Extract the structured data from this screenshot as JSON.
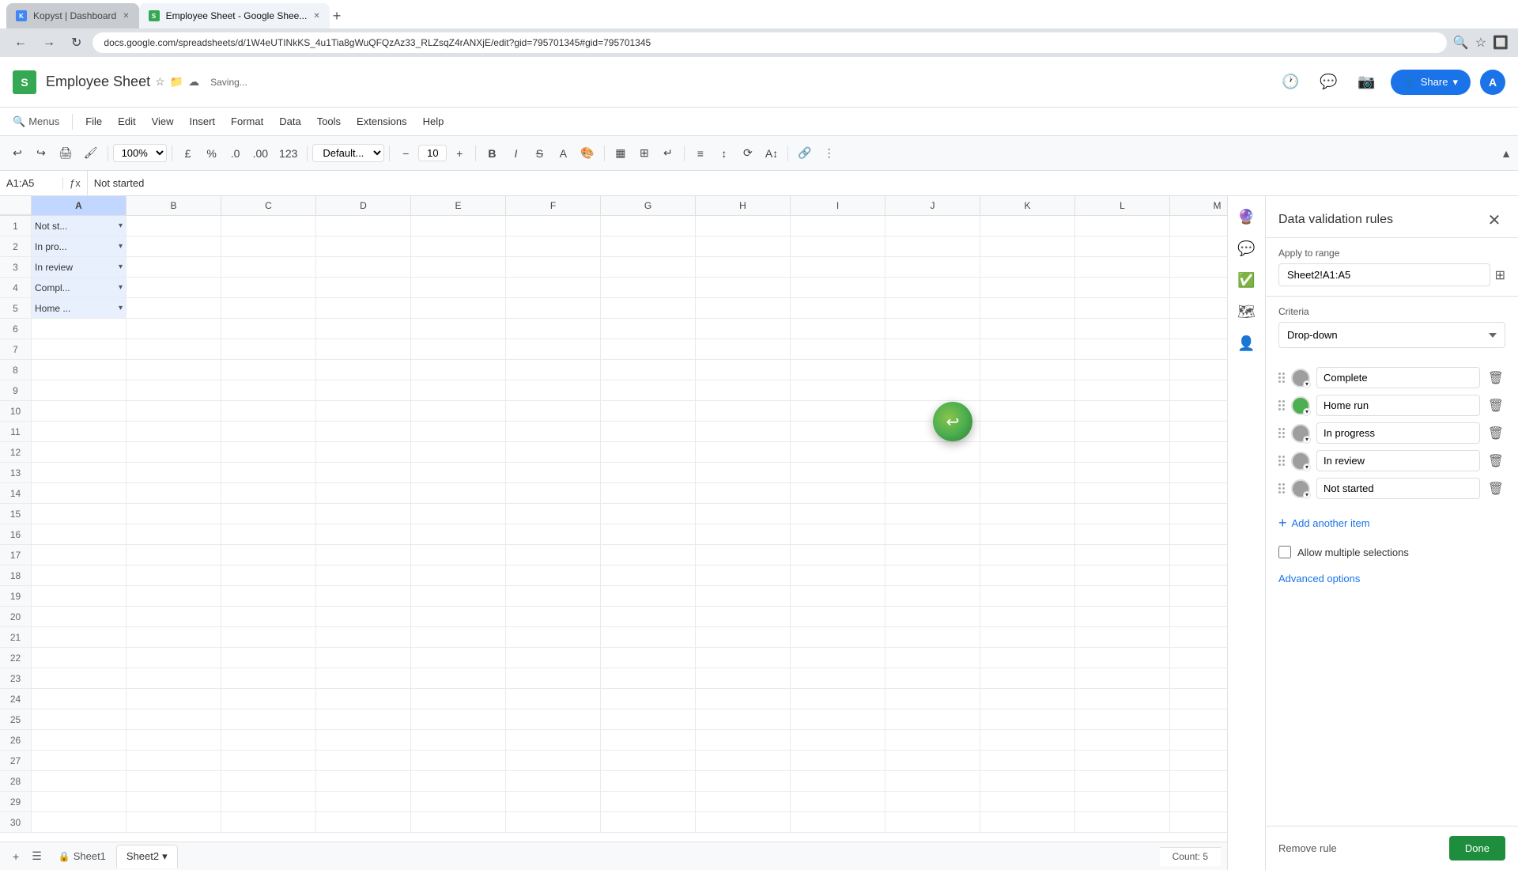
{
  "browser": {
    "tabs": [
      {
        "id": "kopyst",
        "label": "Kopyst | Dashboard",
        "active": false,
        "favicon_color": "#4285f4"
      },
      {
        "id": "sheets",
        "label": "Employee Sheet - Google Shee...",
        "active": true,
        "favicon_color": "#34a853"
      }
    ],
    "address": "docs.google.com/spreadsheets/d/1W4eUTINkKS_4u1Tia8gWuQFQzAz33_RLZsqZ4rANXjE/edit?gid=795701345#gid=795701345",
    "nav": {
      "back": "←",
      "forward": "→",
      "refresh": "↻"
    }
  },
  "header": {
    "logo_letter": "S",
    "file_title": "Employee Sheet",
    "saving_text": "Saving...",
    "share_label": "Share",
    "avatar_letter": "A"
  },
  "menu": {
    "search_label": "Menus",
    "items": [
      "File",
      "Edit",
      "View",
      "Insert",
      "Format",
      "Data",
      "Tools",
      "Extensions",
      "Help"
    ]
  },
  "toolbar": {
    "zoom": "100%",
    "currency": "£",
    "percent": "%",
    "decimal_dec": ".0",
    "decimal_inc": ".00",
    "format_num": "123",
    "font_family": "Default...",
    "font_size": "10"
  },
  "formula_bar": {
    "cell_ref": "A1:A5",
    "content": "Not started"
  },
  "spreadsheet": {
    "columns": [
      "A",
      "B",
      "C",
      "D",
      "E",
      "F",
      "G",
      "H",
      "I",
      "J",
      "K",
      "L",
      "M"
    ],
    "rows": [
      {
        "num": "1",
        "a_value": "Not st...",
        "has_dropdown": true
      },
      {
        "num": "2",
        "a_value": "In pro...",
        "has_dropdown": true
      },
      {
        "num": "3",
        "a_value": "In review",
        "has_dropdown": true
      },
      {
        "num": "4",
        "a_value": "Compl...",
        "has_dropdown": true
      },
      {
        "num": "5",
        "a_value": "Home ...",
        "has_dropdown": true
      },
      {
        "num": "6",
        "a_value": "",
        "has_dropdown": false
      },
      {
        "num": "7",
        "a_value": "",
        "has_dropdown": false
      },
      {
        "num": "8",
        "a_value": "",
        "has_dropdown": false
      },
      {
        "num": "9",
        "a_value": "",
        "has_dropdown": false
      },
      {
        "num": "10",
        "a_value": "",
        "has_dropdown": false
      },
      {
        "num": "11",
        "a_value": "",
        "has_dropdown": false
      },
      {
        "num": "12",
        "a_value": "",
        "has_dropdown": false
      },
      {
        "num": "13",
        "a_value": "",
        "has_dropdown": false
      },
      {
        "num": "14",
        "a_value": "",
        "has_dropdown": false
      },
      {
        "num": "15",
        "a_value": "",
        "has_dropdown": false
      },
      {
        "num": "16",
        "a_value": "",
        "has_dropdown": false
      },
      {
        "num": "17",
        "a_value": "",
        "has_dropdown": false
      },
      {
        "num": "18",
        "a_value": "",
        "has_dropdown": false
      },
      {
        "num": "19",
        "a_value": "",
        "has_dropdown": false
      },
      {
        "num": "20",
        "a_value": "",
        "has_dropdown": false
      },
      {
        "num": "21",
        "a_value": "",
        "has_dropdown": false
      },
      {
        "num": "22",
        "a_value": "",
        "has_dropdown": false
      },
      {
        "num": "23",
        "a_value": "",
        "has_dropdown": false
      },
      {
        "num": "24",
        "a_value": "",
        "has_dropdown": false
      },
      {
        "num": "25",
        "a_value": "",
        "has_dropdown": false
      },
      {
        "num": "26",
        "a_value": "",
        "has_dropdown": false
      },
      {
        "num": "27",
        "a_value": "",
        "has_dropdown": false
      },
      {
        "num": "28",
        "a_value": "",
        "has_dropdown": false
      },
      {
        "num": "29",
        "a_value": "",
        "has_dropdown": false
      },
      {
        "num": "30",
        "a_value": "",
        "has_dropdown": false
      }
    ]
  },
  "side_panel": {
    "title": "Data validation rules",
    "apply_label": "Apply to range",
    "range_value": "Sheet2!A1:A5",
    "criteria_label": "Criteria",
    "criteria_type": "Drop-down",
    "items": [
      {
        "id": "item1",
        "color": "#9e9e9e",
        "value": "Complete"
      },
      {
        "id": "item2",
        "color": "#4caf50",
        "value": "Home run"
      },
      {
        "id": "item3",
        "color": "#9e9e9e",
        "value": "In progress"
      },
      {
        "id": "item4",
        "color": "#9e9e9e",
        "value": "In review"
      },
      {
        "id": "item5",
        "color": "#9e9e9e",
        "value": "Not started"
      }
    ],
    "add_item_label": "Add another item",
    "allow_multiple_label": "Allow multiple selections",
    "advanced_label": "Advanced options",
    "remove_rule_label": "Remove rule",
    "done_label": "Done"
  },
  "sheet_tabs": [
    {
      "id": "sheet1",
      "label": "Sheet1",
      "active": false
    },
    {
      "id": "sheet2",
      "label": "Sheet2",
      "active": true
    }
  ],
  "status_bar": {
    "count_label": "Count: 5"
  },
  "floating_element": {
    "arrow": "↩"
  }
}
